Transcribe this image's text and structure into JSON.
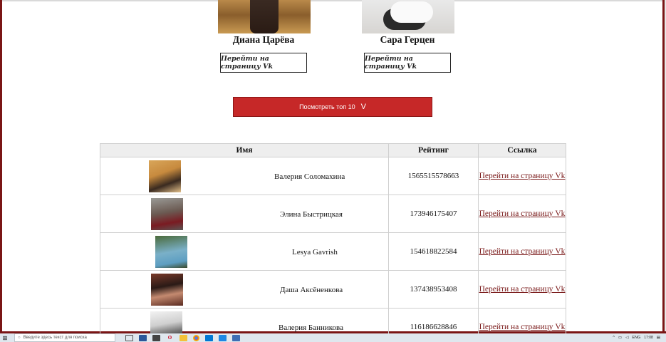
{
  "cards": [
    {
      "name": "Диана Царёва",
      "button": "Перейти на страницу Vk"
    },
    {
      "name": "Сара Герцен",
      "button": "Перейти на страницу Vk"
    }
  ],
  "top_button": {
    "label": "Посмотреть топ 10",
    "chevron": "V"
  },
  "table": {
    "headers": [
      "Имя",
      "Рейтинг",
      "Ссылка"
    ],
    "rows": [
      {
        "name": "Валерия Соломахина",
        "rating": "1565515578663",
        "link": "Перейти на страницу Vk"
      },
      {
        "name": "Элина Быстрицкая",
        "rating": "173946175407",
        "link": "Перейти на страницу Vk"
      },
      {
        "name": "Lesya Gavrish",
        "rating": "154618822584",
        "link": "Перейти на страницу Vk"
      },
      {
        "name": "Даша Аксёненкова",
        "rating": "137438953408",
        "link": "Перейти на страницу Vk"
      },
      {
        "name": "Валерия Банникова",
        "rating": "116186628846",
        "link": "Перейти на страницу Vk"
      }
    ]
  },
  "taskbar": {
    "search_placeholder": "Введите здесь текст для поиска",
    "icons": [
      "start-icon",
      "search-icon",
      "task-view-icon",
      "word-icon",
      "mail-icon",
      "opera-icon",
      "explorer-icon",
      "chrome-icon",
      "vscode-icon",
      "app-icon",
      "app-icon"
    ],
    "language": "ENG",
    "time": "17:08"
  },
  "colors": {
    "accent": "#c62828",
    "frame": "#7a1515",
    "link": "#7a1a1a"
  }
}
